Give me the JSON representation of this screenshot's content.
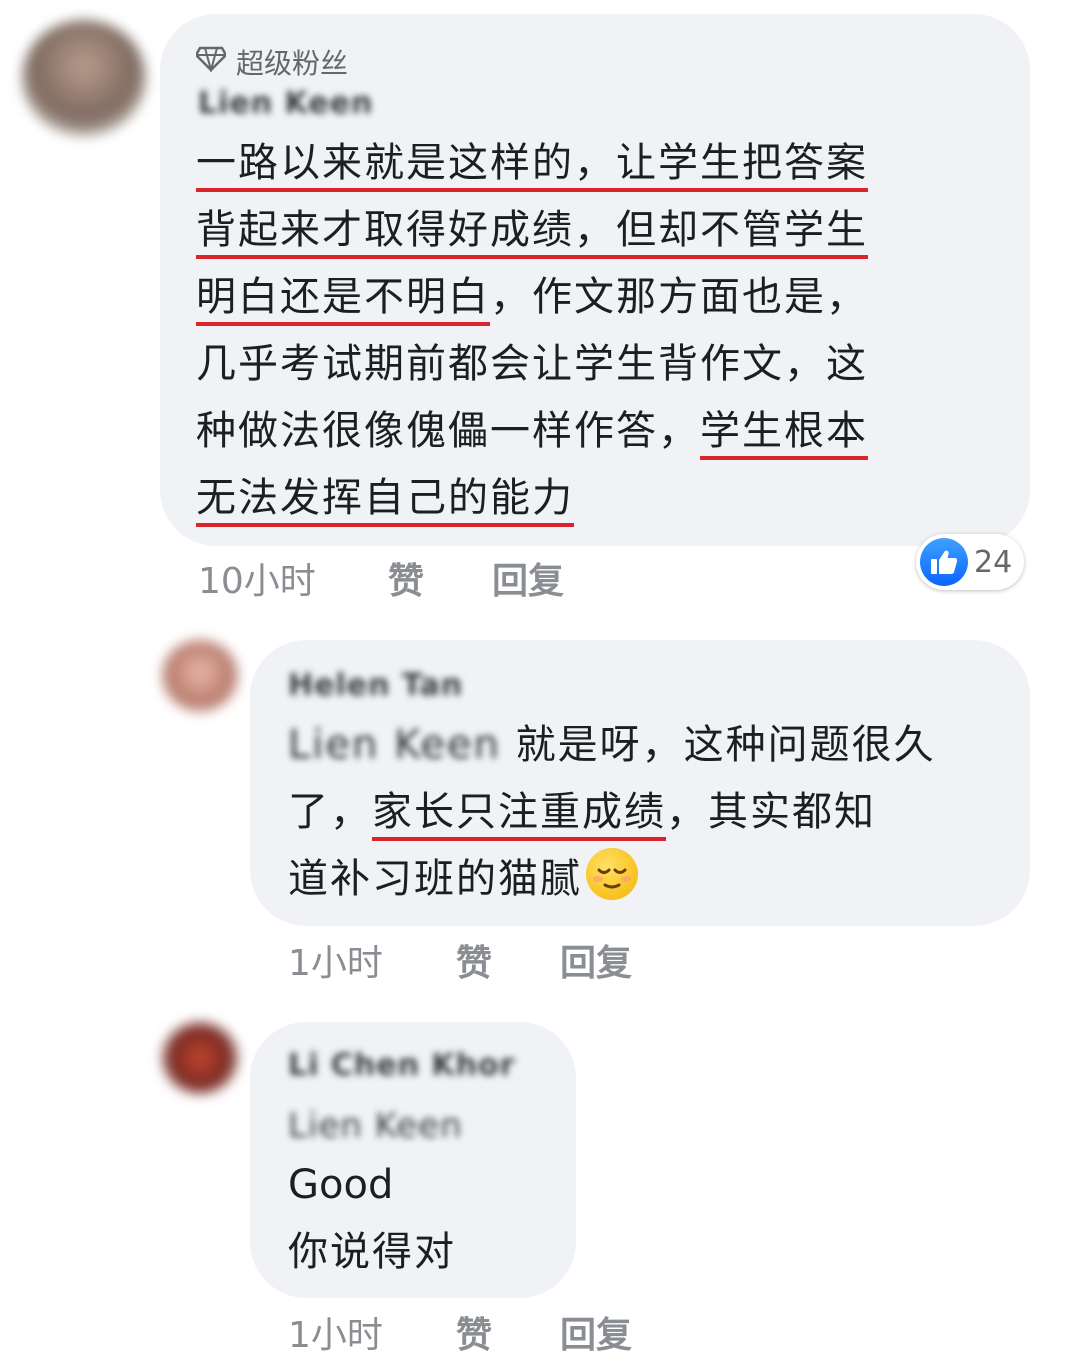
{
  "comment1": {
    "badge": "超级粉丝",
    "author": "Lien Keen",
    "lines": [
      "一路以来就是这样的，让学生把答案",
      "背起来才取得好成绩，但却不管学生",
      "明白还是不明白",
      "，作文那方面也是，",
      "几乎考试期前都会让学生背作文，这",
      "种做法很像傀儡一样作答，",
      "学生根本",
      "无法发挥自己的能力"
    ],
    "time": "10小时",
    "like": "赞",
    "reply": "回复",
    "reaction_count": "24",
    "reaction_icon": "like-icon"
  },
  "comment2": {
    "author": "Helen Tan",
    "mention": "Lien Keen",
    "line1": " 就是呀，这种问题很久",
    "line2_a": "了，",
    "line2_b": "家长只注重成绩",
    "line2_c": "，其实都知",
    "line3": "道补习班的猫腻",
    "emoji": "relieved-face-icon",
    "time": "1小时",
    "like": "赞",
    "reply": "回复"
  },
  "comment3": {
    "author": "Li Chen Khor",
    "mention": "Lien Keen",
    "line1": "Good",
    "line2": "你说得对",
    "time": "1小时",
    "like": "赞",
    "reply": "回复"
  }
}
